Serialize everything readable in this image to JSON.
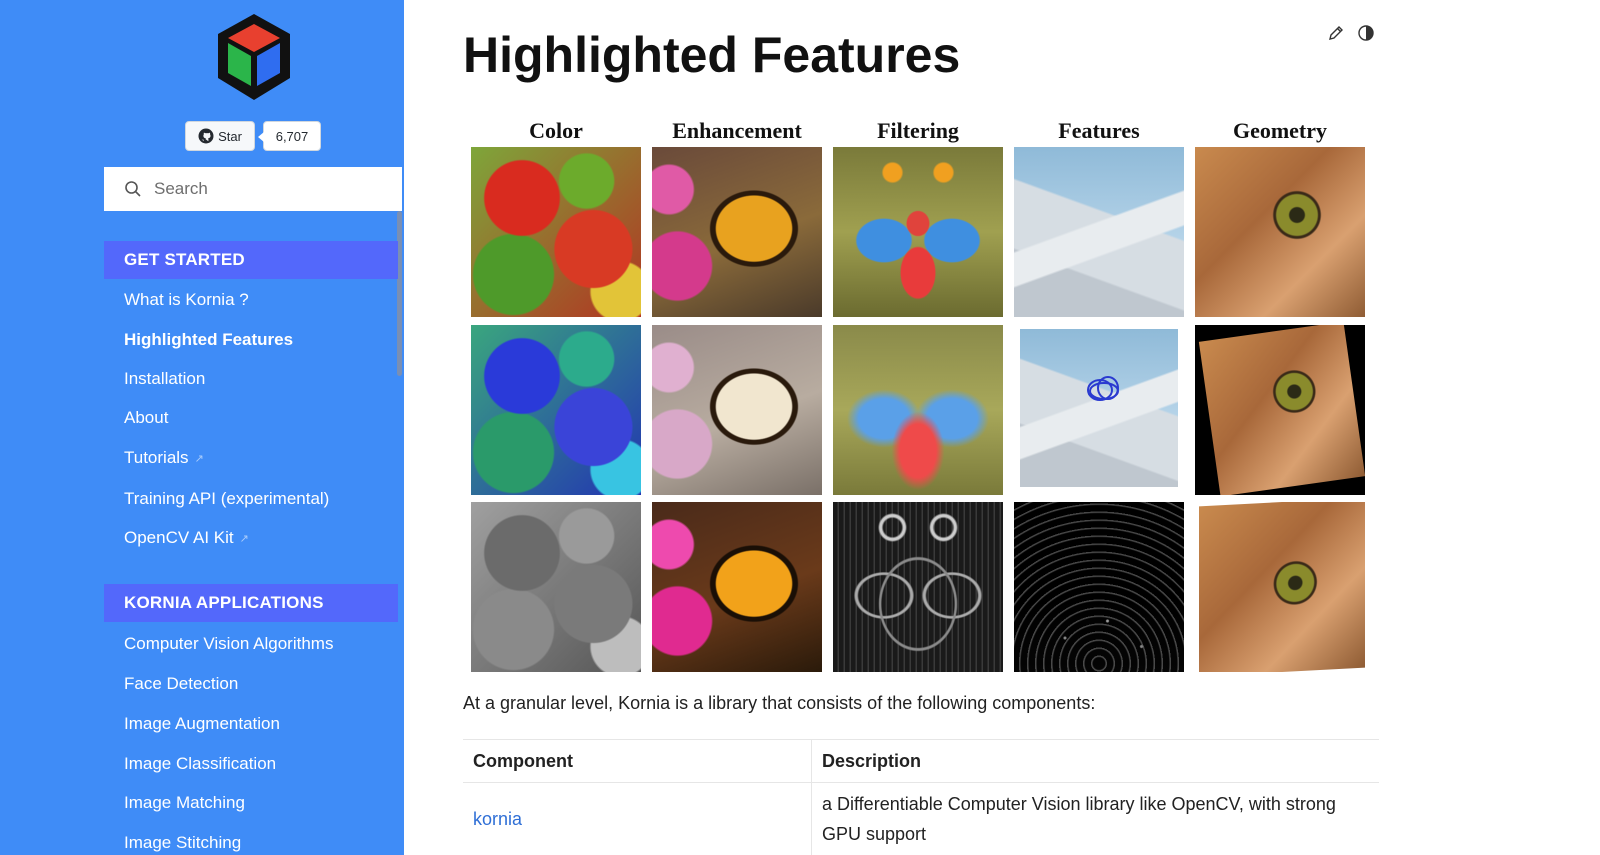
{
  "sidebar": {
    "github": {
      "star_label": "Star",
      "count": "6,707"
    },
    "search": {
      "placeholder": "Search"
    },
    "sections": [
      {
        "heading": "GET STARTED",
        "items": [
          {
            "label": "What is Kornia ?"
          },
          {
            "label": "Highlighted Features",
            "active": true
          },
          {
            "label": "Installation"
          },
          {
            "label": "About"
          },
          {
            "label": "Tutorials",
            "external": true
          },
          {
            "label": "Training API (experimental)"
          },
          {
            "label": "OpenCV AI Kit",
            "external": true
          }
        ]
      },
      {
        "heading": "KORNIA APPLICATIONS",
        "items": [
          {
            "label": "Computer Vision Algorithms"
          },
          {
            "label": "Face Detection"
          },
          {
            "label": "Image Augmentation"
          },
          {
            "label": "Image Classification"
          },
          {
            "label": "Image Matching"
          },
          {
            "label": "Image Stitching"
          }
        ]
      }
    ]
  },
  "main": {
    "title": "Highlighted Features",
    "toolbar": {
      "edit_icon": "pencil-icon",
      "theme_icon": "theme-toggle-icon"
    },
    "grid": {
      "columns": [
        "Color",
        "Enhancement",
        "Filtering",
        "Features",
        "Geometry"
      ]
    },
    "intro": "At a granular level, Kornia is a library that consists of the following components:",
    "table": {
      "headers": [
        "Component",
        "Description"
      ],
      "rows": [
        {
          "component": "kornia",
          "description": "a Differentiable Computer Vision library like OpenCV, with strong GPU support"
        }
      ]
    }
  },
  "colors": {
    "sidebar_bg": "#3f8cf7",
    "section_head_bg": "#5368fb",
    "link": "#2f6fd6"
  }
}
